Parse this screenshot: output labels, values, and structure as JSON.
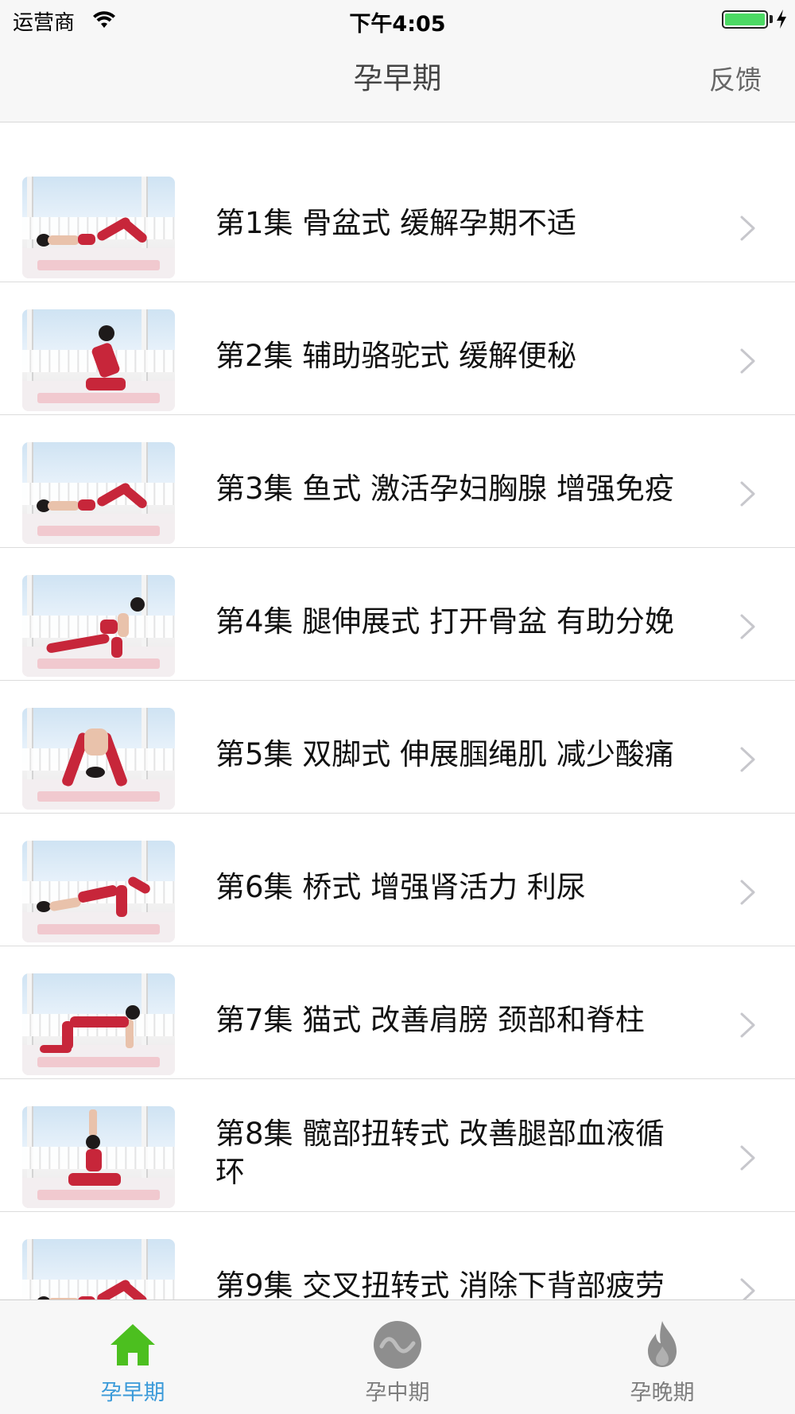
{
  "status_bar": {
    "carrier": "运营商",
    "time": "下午4:05",
    "battery_color": "#4cd964"
  },
  "nav": {
    "title": "孕早期",
    "right_button": "反馈"
  },
  "episodes": [
    {
      "title": "第1集 骨盆式 缓解孕期不适"
    },
    {
      "title": "第2集 辅助骆驼式 缓解便秘"
    },
    {
      "title": "第3集 鱼式 激活孕妇胸腺 增强免疫"
    },
    {
      "title": "第4集 腿伸展式 打开骨盆 有助分娩"
    },
    {
      "title": "第5集 双脚式 伸展腘绳肌 减少酸痛"
    },
    {
      "title": "第6集 桥式 增强肾活力 利尿"
    },
    {
      "title": "第7集 猫式 改善肩膀 颈部和脊柱"
    },
    {
      "title": "第8集 髋部扭转式 改善腿部血液循环"
    },
    {
      "title": "第9集 交叉扭转式 消除下背部疲劳"
    }
  ],
  "tabs": [
    {
      "label": "孕早期",
      "icon": "home-icon",
      "active": true,
      "color": "#4cbf1f"
    },
    {
      "label": "孕中期",
      "icon": "wave-circle-icon",
      "active": false,
      "color": "#8e8e8e"
    },
    {
      "label": "孕晚期",
      "icon": "flame-icon",
      "active": false,
      "color": "#8e8e8e"
    }
  ],
  "colors": {
    "accent_blue": "#3a9ad9",
    "bar_bg": "#f7f7f7",
    "chevron": "#c7c7cc"
  }
}
